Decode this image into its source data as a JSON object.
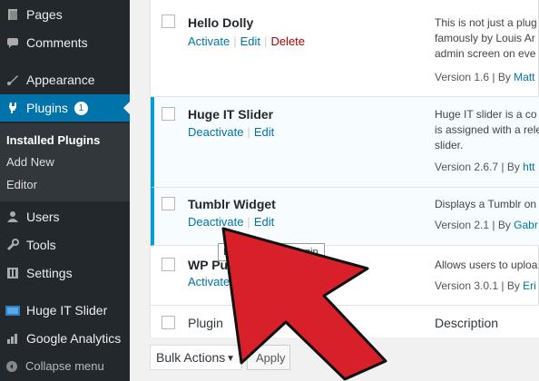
{
  "sidebar": {
    "items": [
      {
        "label": "Pages",
        "icon": "pages-icon"
      },
      {
        "label": "Comments",
        "icon": "comments-icon"
      },
      {
        "label": "Appearance",
        "icon": "appearance-icon"
      },
      {
        "label": "Plugins",
        "icon": "plugins-icon",
        "badge": "1"
      },
      {
        "label": "Users",
        "icon": "users-icon"
      },
      {
        "label": "Tools",
        "icon": "tools-icon"
      },
      {
        "label": "Settings",
        "icon": "settings-icon"
      },
      {
        "label": "Huge IT Slider",
        "icon": "slider-icon"
      },
      {
        "label": "Google Analytics",
        "icon": "analytics-icon"
      }
    ],
    "submenu": [
      "Installed Plugins",
      "Add New",
      "Editor"
    ],
    "collapse_label": "Collapse menu"
  },
  "plugins": [
    {
      "name": "Hello Dolly",
      "actions": [
        "Activate",
        "Edit",
        "Delete"
      ],
      "description": [
        "This is not just a plug",
        "famously by Louis Ar",
        "admin screen on eve"
      ],
      "version": "Version 1.6 | By ",
      "author": "Matt"
    },
    {
      "name": "Huge IT Slider",
      "actions": [
        "Deactivate",
        "Edit"
      ],
      "description": [
        "Huge IT slider is a co",
        "is assigned with a rele",
        "slider."
      ],
      "version": "Version 2.6.7 | By ",
      "author": "htt"
    },
    {
      "name": "Tumblr Widget",
      "actions": [
        "Deactivate",
        "Edit"
      ],
      "description": [
        "Displays a Tumblr on"
      ],
      "version": "Version 2.1 | By ",
      "author": "Gabr"
    },
    {
      "name": "WP Publi",
      "actions": [
        "Activate",
        "E"
      ],
      "description": [
        "Allows users to uploa"
      ],
      "version": "Version 3.0.1 | By ",
      "author": "Eri"
    }
  ],
  "table_header": {
    "plugin": "Plugin",
    "description": "Description"
  },
  "bulk_actions": {
    "label": "Bulk Actions",
    "apply": "Apply"
  },
  "tooltip": "Deactivate this plugin",
  "colors": {
    "sidebar": "#23282d",
    "accent": "#0073aa",
    "active_border": "#00a0d2",
    "arrow": "#d8202a"
  }
}
